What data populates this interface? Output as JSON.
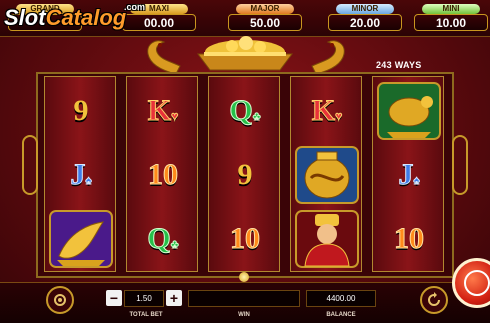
{
  "watermark": {
    "slot": "Slot",
    "catalog": "Catalog",
    "com": ".com"
  },
  "jackpots": [
    {
      "label": "GRAND",
      "value": ""
    },
    {
      "label": "MAXI",
      "value": "00.00"
    },
    {
      "label": "MAJOR",
      "value": "50.00"
    },
    {
      "label": "MINOR",
      "value": "20.00"
    },
    {
      "label": "MINI",
      "value": "10.00"
    }
  ],
  "ways": "243 WAYS",
  "reels": [
    [
      {
        "type": "card",
        "text": "9",
        "style": "gold"
      },
      {
        "type": "card",
        "text": "J",
        "style": "blue",
        "suit": "♠"
      },
      {
        "type": "picture",
        "icon": "golden-carp-icon"
      }
    ],
    [
      {
        "type": "card",
        "text": "K",
        "style": "red",
        "suit": "♥"
      },
      {
        "type": "card",
        "text": "10",
        "style": "orange"
      },
      {
        "type": "card",
        "text": "Q",
        "style": "green",
        "suit": "♣"
      }
    ],
    [
      {
        "type": "card",
        "text": "Q",
        "style": "green",
        "suit": "♣"
      },
      {
        "type": "card",
        "text": "9",
        "style": "gold"
      },
      {
        "type": "card",
        "text": "10",
        "style": "orange"
      }
    ],
    [
      {
        "type": "card",
        "text": "K",
        "style": "red",
        "suit": "♥"
      },
      {
        "type": "picture",
        "icon": "golden-dragon-vase-icon"
      },
      {
        "type": "picture",
        "icon": "fortune-god-icon"
      }
    ],
    [
      {
        "type": "picture",
        "icon": "golden-turtle-icon"
      },
      {
        "type": "card",
        "text": "J",
        "style": "blue",
        "suit": "♠"
      },
      {
        "type": "card",
        "text": "10",
        "style": "orange"
      }
    ]
  ],
  "controls": {
    "settings_icon": "gear-icon",
    "minus": "−",
    "plus": "+",
    "total_bet_value": "1.50",
    "total_bet_label": "TOTAL BET",
    "win_value": "",
    "win_label": "WIN",
    "balance_value": "4400.00",
    "balance_label": "BALANCE",
    "autoplay_icon": "refresh-icon",
    "spin_icon": "spin-icon"
  },
  "colors": {
    "background": "#5c0a0e",
    "gold": "#c79a2a",
    "spin": "#d22012"
  }
}
